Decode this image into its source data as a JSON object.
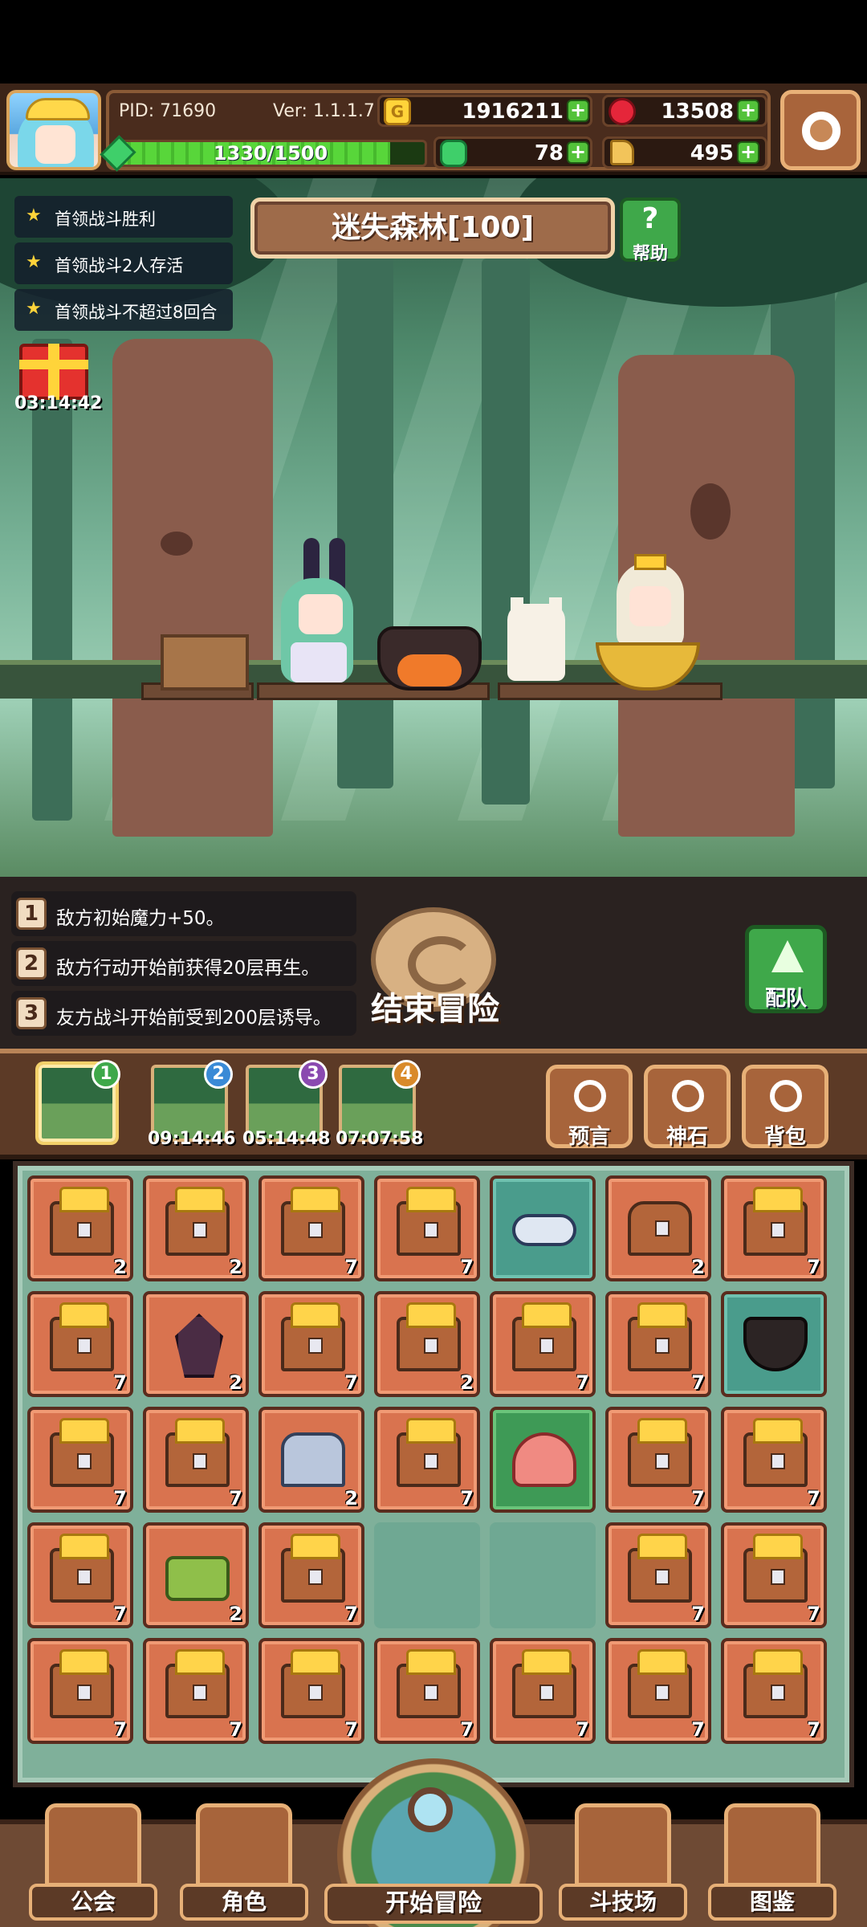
{
  "header": {
    "pid": "PID: 71690",
    "version": "Ver: 1.1.1.7",
    "gold": "1916211",
    "gems": "13508",
    "clover": "78",
    "boots": "495",
    "stamina_text": "1330/1500",
    "stamina_fraction": 0.887
  },
  "quests": [
    "首领战斗胜利",
    "首领战斗2人存活",
    "首领战斗不超过8回合"
  ],
  "stage": {
    "title": "迷失森林[100]",
    "help_label": "帮助"
  },
  "gift": {
    "timer": "03:14:42"
  },
  "modifiers": [
    {
      "num": "1",
      "text": "敌方初始魔力+50。"
    },
    {
      "num": "2",
      "text": "敌方行动开始前获得20层再生。"
    },
    {
      "num": "3",
      "text": "友方战斗开始前受到200层诱导。"
    }
  ],
  "actions": {
    "end_adventure": "结束冒险",
    "team": "配队"
  },
  "stage_tabs": [
    {
      "badge": "1",
      "badge_color": "#3ea84a",
      "timer": ""
    },
    {
      "badge": "2",
      "badge_color": "#3a8ad6",
      "timer": "09:14:46"
    },
    {
      "badge": "3",
      "badge_color": "#8a4ab0",
      "timer": "05:14:48"
    },
    {
      "badge": "4",
      "badge_color": "#d98a2a",
      "timer": "07:07:58"
    }
  ],
  "side_buttons": {
    "prophecy": "预言",
    "godstone": "神石",
    "backpack": "背包"
  },
  "inventory": [
    [
      {
        "type": "chest",
        "count": "2"
      },
      {
        "type": "chest",
        "count": "2"
      },
      {
        "type": "chest",
        "count": "7"
      },
      {
        "type": "chest",
        "count": "7"
      },
      {
        "type": "scroll",
        "count": ""
      },
      {
        "type": "chest-closed",
        "count": "2"
      },
      {
        "type": "chest",
        "count": "7"
      }
    ],
    [
      {
        "type": "chest",
        "count": "7"
      },
      {
        "type": "crystal",
        "count": "2"
      },
      {
        "type": "chest",
        "count": "7"
      },
      {
        "type": "chest",
        "count": "2"
      },
      {
        "type": "chest",
        "count": "7"
      },
      {
        "type": "chest",
        "count": "7"
      },
      {
        "type": "cauldron",
        "count": ""
      }
    ],
    [
      {
        "type": "chest",
        "count": "7"
      },
      {
        "type": "chest",
        "count": "7"
      },
      {
        "type": "silver-chest",
        "count": "2"
      },
      {
        "type": "chest",
        "count": "7"
      },
      {
        "type": "slime",
        "count": ""
      },
      {
        "type": "chest",
        "count": "7"
      },
      {
        "type": "chest",
        "count": "7"
      }
    ],
    [
      {
        "type": "chest",
        "count": "7"
      },
      {
        "type": "green-chest",
        "count": "2"
      },
      {
        "type": "chest",
        "count": "7"
      },
      {
        "type": "empty",
        "count": ""
      },
      {
        "type": "empty",
        "count": ""
      },
      {
        "type": "chest",
        "count": "7"
      },
      {
        "type": "chest",
        "count": "7"
      }
    ],
    [
      {
        "type": "chest",
        "count": "7"
      },
      {
        "type": "chest",
        "count": "7"
      },
      {
        "type": "chest",
        "count": "7"
      },
      {
        "type": "chest",
        "count": "7"
      },
      {
        "type": "chest",
        "count": "7"
      },
      {
        "type": "chest",
        "count": "7"
      },
      {
        "type": "chest",
        "count": "7"
      }
    ]
  ],
  "nav": {
    "guild": "公会",
    "character": "角色",
    "start_adventure": "开始冒险",
    "arena": "斗技场",
    "codex": "图鉴"
  }
}
